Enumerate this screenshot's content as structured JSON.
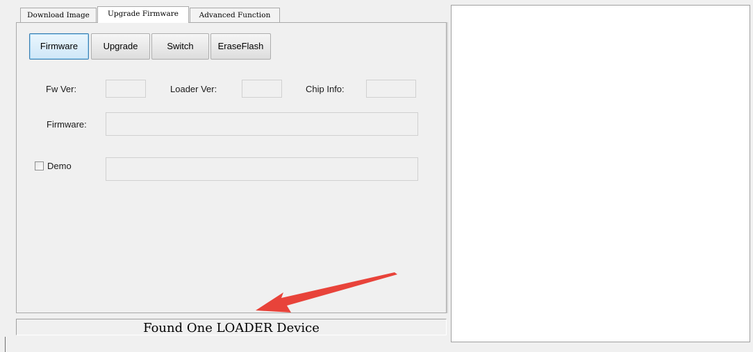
{
  "tabs": [
    {
      "label": "Download Image",
      "active": false
    },
    {
      "label": "Upgrade Firmware",
      "active": true
    },
    {
      "label": "Advanced Function",
      "active": false
    }
  ],
  "buttons": {
    "firmware": "Firmware",
    "upgrade": "Upgrade",
    "switch": "Switch",
    "erase_flash": "EraseFlash"
  },
  "fields": {
    "fw_ver_label": "Fw Ver:",
    "fw_ver_value": "",
    "loader_ver_label": "Loader Ver:",
    "loader_ver_value": "",
    "chip_info_label": "Chip Info:",
    "chip_info_value": "",
    "firmware_label": "Firmware:",
    "firmware_value": "",
    "demo_label": "Demo",
    "demo_checked": false,
    "demo_value": ""
  },
  "status": {
    "message": "Found One LOADER Device"
  },
  "log": {
    "content": ""
  },
  "colors": {
    "arrow": "#e8433a",
    "focus_border": "#3c7fb1",
    "background": "#f0f0f0"
  },
  "icons": {
    "annotation": "red-arrow-icon"
  }
}
